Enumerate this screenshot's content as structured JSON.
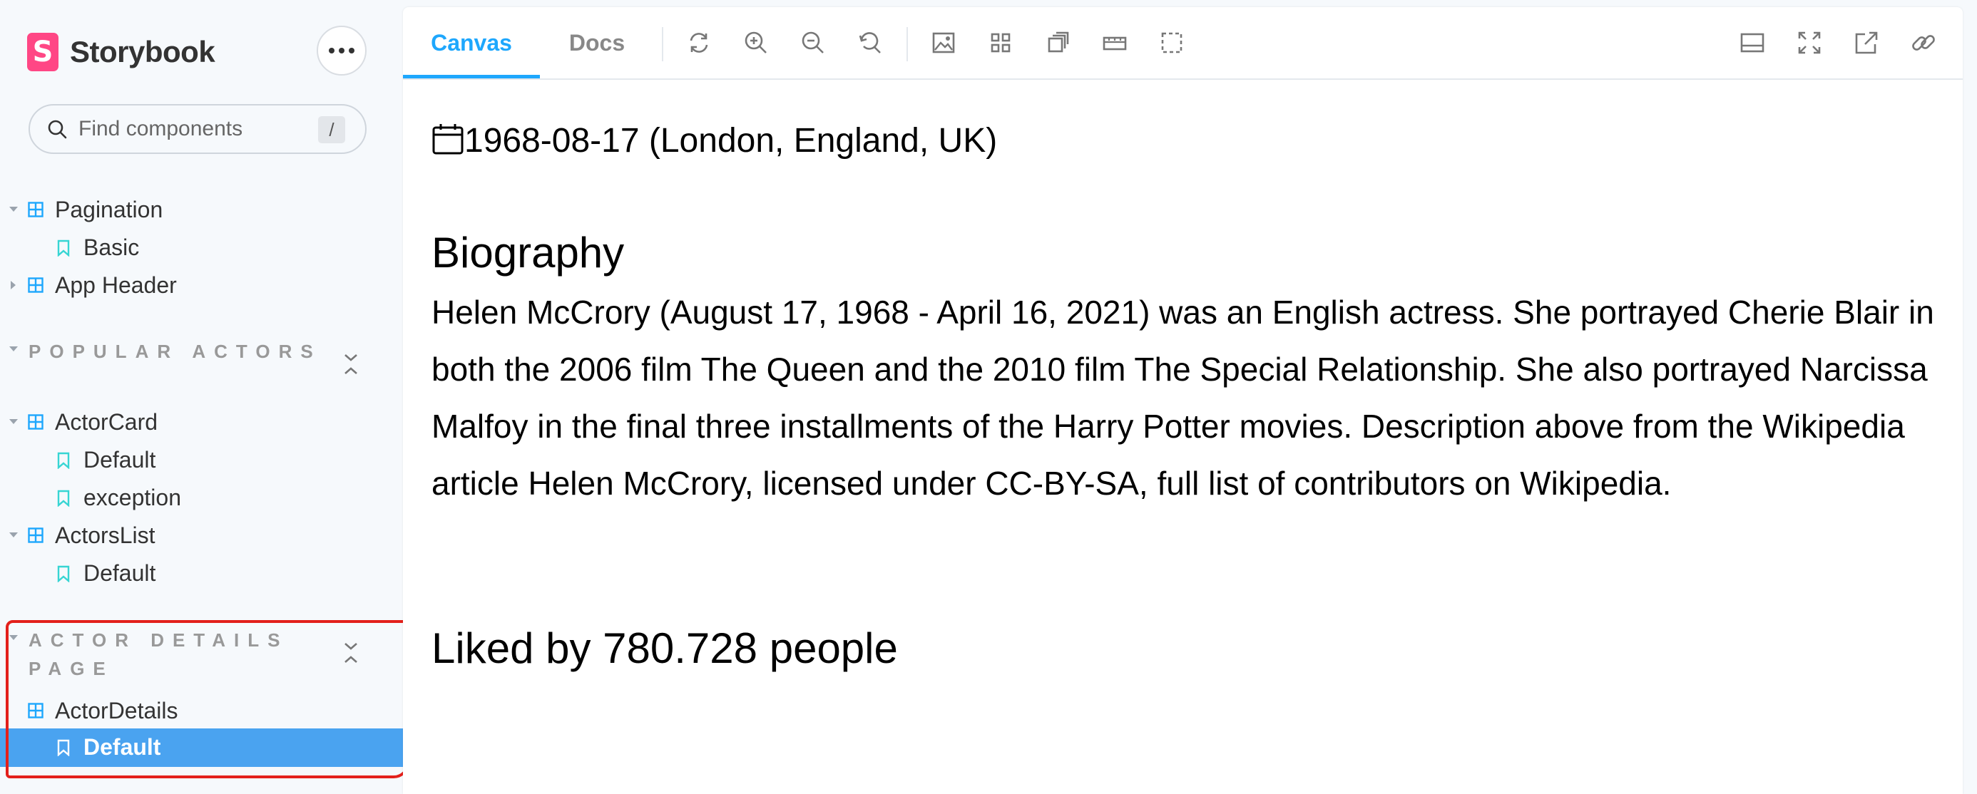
{
  "app": {
    "brand_name": "Storybook",
    "brand_letter": "S",
    "brand_color": "#ff4785",
    "accent_color": "#1ea7fd",
    "selected_color": "#4aa3f0"
  },
  "sidebar": {
    "more_icon": "more-icon",
    "search": {
      "placeholder": "Find components",
      "shortcut": "/"
    },
    "items": [
      {
        "label": "Pagination"
      },
      {
        "label": "Basic"
      },
      {
        "label": "App Header"
      }
    ],
    "groups": [
      {
        "title": "POPULAR ACTORS",
        "items": [
          {
            "label": "ActorCard"
          },
          {
            "label": "Default"
          },
          {
            "label": "exception"
          },
          {
            "label": "ActorsList"
          },
          {
            "label": "Default"
          }
        ]
      },
      {
        "title": "ACTOR DETAILS PAGE",
        "items": [
          {
            "label": "ActorDetails"
          },
          {
            "label": "Default"
          }
        ]
      }
    ]
  },
  "toolbar": {
    "tabs": [
      {
        "label": "Canvas"
      },
      {
        "label": "Docs"
      }
    ],
    "tools_left": [
      "reload-icon",
      "zoom-in-icon",
      "zoom-out-icon",
      "zoom-reset-icon",
      "background-icon",
      "grid-icon",
      "viewport-icon",
      "measure-icon",
      "outline-icon"
    ],
    "tools_right": [
      "addons-panel-icon",
      "fullscreen-icon",
      "open-new-tab-icon",
      "copy-link-icon"
    ]
  },
  "preview": {
    "birth": "1968-08-17 (London, England, UK)",
    "bio_heading": "Biography",
    "bio_text": "Helen McCrory (August 17, 1968 - April 16, 2021) was an English actress. She portrayed Cherie Blair in both the 2006 film The Queen and the 2010 film The Special Relationship. She also portrayed Narcissa Malfoy in the final three installments of the Harry Potter movies. Description above from the Wikipedia article Helen McCrory, licensed under CC-BY-SA, full list of contributors on Wikipedia.",
    "liked": "Liked by 780.728 people"
  }
}
